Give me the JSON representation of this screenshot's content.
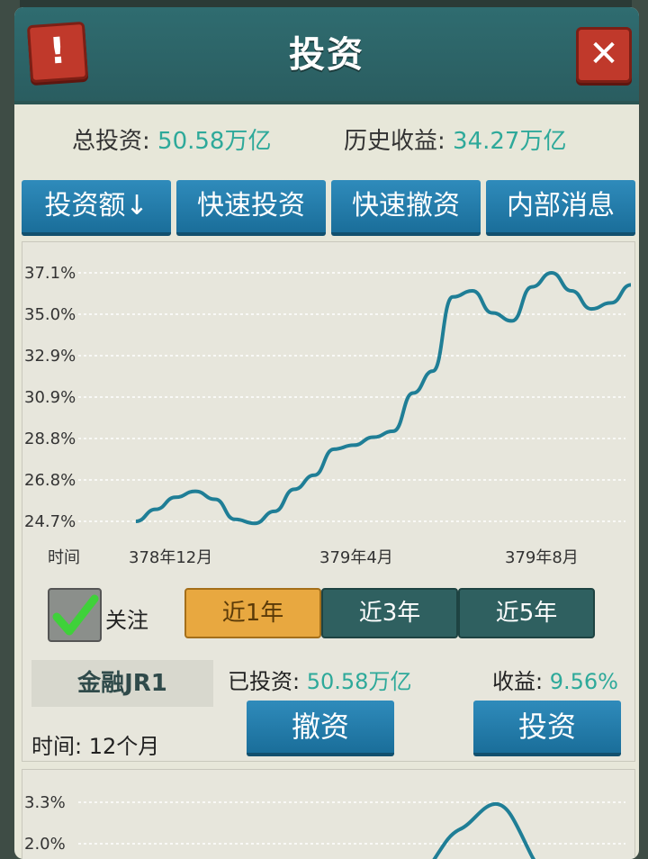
{
  "header": {
    "title": "投资",
    "alert_icon": "exclamation-icon",
    "close_icon": "close-icon"
  },
  "summary": {
    "total_label": "总投资:",
    "total_value": "50.58万亿",
    "history_label": "历史收益:",
    "history_value": "34.27万亿"
  },
  "tabs": [
    "投资额↓",
    "快速投资",
    "快速撤资",
    "内部消息"
  ],
  "chart_data": {
    "type": "line",
    "y_ticks": [
      "37.1%",
      "35.0%",
      "32.9%",
      "30.9%",
      "28.8%",
      "26.8%",
      "24.7%"
    ],
    "ylim": [
      24.7,
      37.1
    ],
    "xlabel": "时间",
    "x_ticks": [
      "378年12月",
      "379年4月",
      "379年8月"
    ],
    "series": [
      {
        "values": [
          24.7,
          25.3,
          25.9,
          26.2,
          25.8,
          24.8,
          24.6,
          25.2,
          26.3,
          27.0,
          28.3,
          28.5,
          28.9,
          29.2,
          31.1,
          32.2,
          35.9,
          36.2,
          35.1,
          34.7,
          36.4,
          37.1,
          36.2,
          35.3,
          35.6,
          36.5
        ]
      }
    ],
    "grid": true
  },
  "controls": {
    "follow_label": "关注",
    "follow_checked": true,
    "ranges": [
      "近1年",
      "近3年",
      "近5年"
    ],
    "active_range": "近1年"
  },
  "fund": {
    "name": "金融JR1",
    "invested_label": "已投资:",
    "invested_value": "50.58万亿",
    "return_label": "收益:",
    "return_value": "9.56%",
    "time_label": "时间:",
    "time_value": "12个月",
    "withdraw_label": "撤资",
    "invest_label": "投资"
  },
  "chart2": {
    "y_ticks": [
      "3.3%",
      "2.0%"
    ]
  },
  "colors": {
    "accent": "#2ea99a",
    "line": "#1f7e96",
    "header": "#2f6c70",
    "button": "#1f7fae",
    "active": "#e8a840"
  }
}
